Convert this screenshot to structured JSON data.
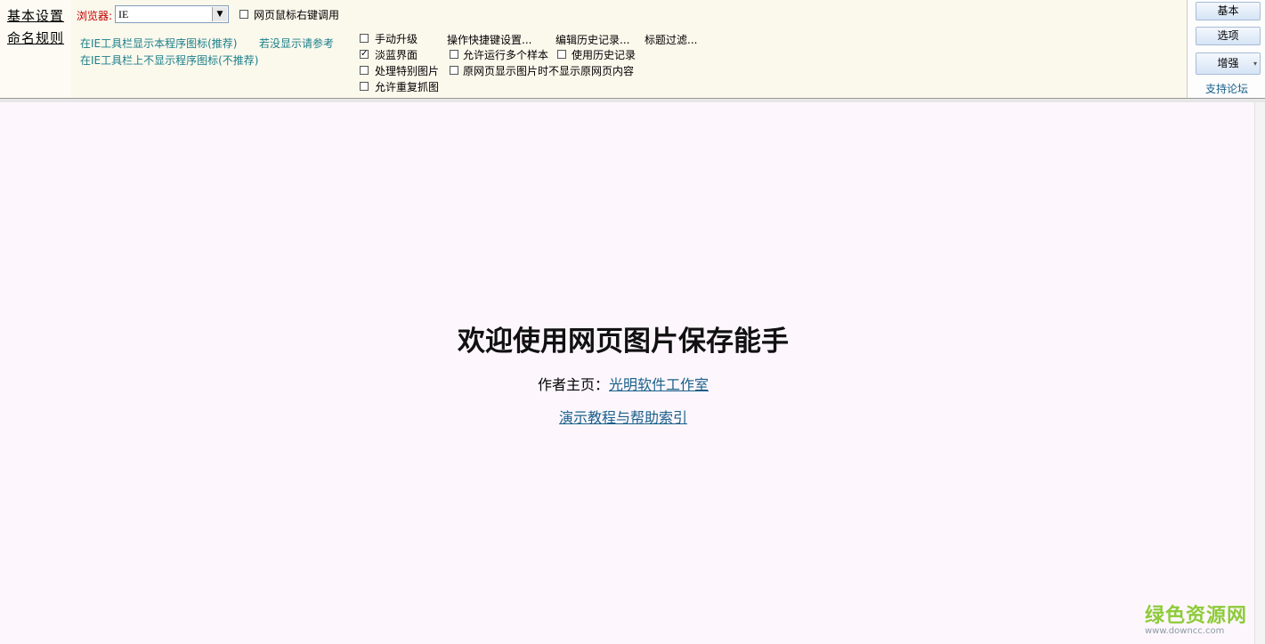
{
  "nav": {
    "basic_settings": "基本设置",
    "naming_rules": "命名规则"
  },
  "browser": {
    "label": "浏览器:",
    "value": "IE"
  },
  "right_click_checkbox": {
    "label": "网页鼠标右键调用",
    "checked": false
  },
  "toolbar_links": {
    "show_icon": "在IE工具栏显示本程序图标(推荐)",
    "hide_icon": "在IE工具栏上不显示程序图标(不推荐)",
    "reference": "若没显示请参考"
  },
  "options": [
    {
      "label": "手动升级",
      "checked": false
    },
    {
      "label": "淡蓝界面",
      "checked": true
    },
    {
      "label": "处理特别图片",
      "checked": false
    },
    {
      "label": "允许重复抓图",
      "checked": false
    },
    {
      "label": "允许运行多个样本",
      "checked": false
    },
    {
      "label": "原网页显示图片时不显示原网页内容",
      "checked": false
    },
    {
      "label": "使用历史记录",
      "checked": false
    }
  ],
  "menu": {
    "shortcut_settings": "操作快捷键设置...",
    "edit_history": "编辑历史记录...",
    "title_filter": "标题过滤..."
  },
  "right_panel": {
    "basic": "基本",
    "options": "选项",
    "enhance": "增强",
    "forum": "支持论坛"
  },
  "main": {
    "welcome": "欢迎使用网页图片保存能手",
    "author_prefix": "作者主页：",
    "author_link": "光明软件工作室",
    "help_link": "演示教程与帮助索引"
  },
  "watermark": {
    "cn": "绿色资源网",
    "url": "www.downcc.com"
  },
  "colors": {
    "toolbar_bg": "#fbf8ec",
    "content_bg": "#fdf7fd",
    "link": "#1a7f8a",
    "browser_label": "#c00000"
  }
}
